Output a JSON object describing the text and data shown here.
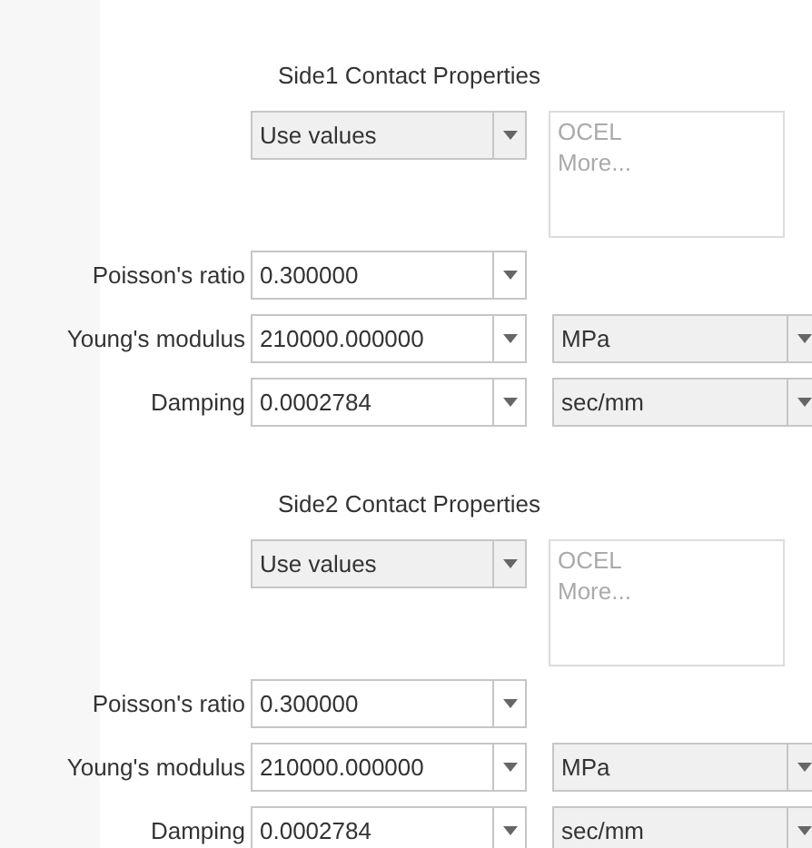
{
  "sections": [
    {
      "title": "Side1 Contact Properties",
      "mode": "Use values",
      "material_list": {
        "disabled": true,
        "items": [
          "OCEL",
          "More..."
        ]
      },
      "rows": [
        {
          "label": "Poisson's ratio",
          "value": "0.300000"
        },
        {
          "label": "Young's modulus",
          "value": "210000.000000",
          "unit": "MPa"
        },
        {
          "label": "Damping",
          "value": "0.0002784",
          "unit": "sec/mm"
        }
      ]
    },
    {
      "title": "Side2 Contact Properties",
      "mode": "Use values",
      "material_list": {
        "disabled": true,
        "items": [
          "OCEL",
          "More..."
        ]
      },
      "rows": [
        {
          "label": "Poisson's ratio",
          "value": "0.300000"
        },
        {
          "label": "Young's modulus",
          "value": "210000.000000",
          "unit": "MPa"
        },
        {
          "label": "Damping",
          "value": "0.0002784",
          "unit": "sec/mm"
        }
      ]
    }
  ]
}
